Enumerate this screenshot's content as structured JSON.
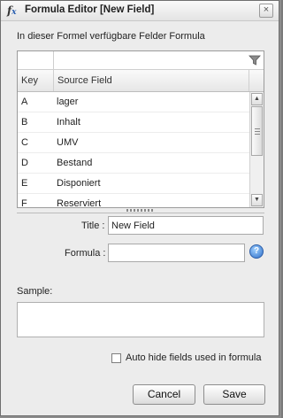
{
  "window": {
    "title": "Formula Editor [New Field]",
    "close_label": "×"
  },
  "caption": "In dieser Formel verfügbare Felder Formula",
  "grid": {
    "columns": [
      "Key",
      "Source Field"
    ],
    "rows": [
      {
        "key": "A",
        "field": "lager"
      },
      {
        "key": "B",
        "field": "Inhalt"
      },
      {
        "key": "C",
        "field": "UMV"
      },
      {
        "key": "D",
        "field": "Bestand"
      },
      {
        "key": "E",
        "field": "Disponiert"
      },
      {
        "key": "F",
        "field": "Reserviert"
      }
    ]
  },
  "form": {
    "title_label": "Title :",
    "title_value": "New Field",
    "formula_label": "Formula :",
    "formula_value": "",
    "sample_label": "Sample:",
    "auto_hide_label": "Auto hide fields used in formula"
  },
  "buttons": {
    "cancel": "Cancel",
    "save": "Save"
  },
  "icons": {
    "app": "fx-icon",
    "filter": "filter-icon",
    "help": "help-icon",
    "close": "close-icon"
  }
}
